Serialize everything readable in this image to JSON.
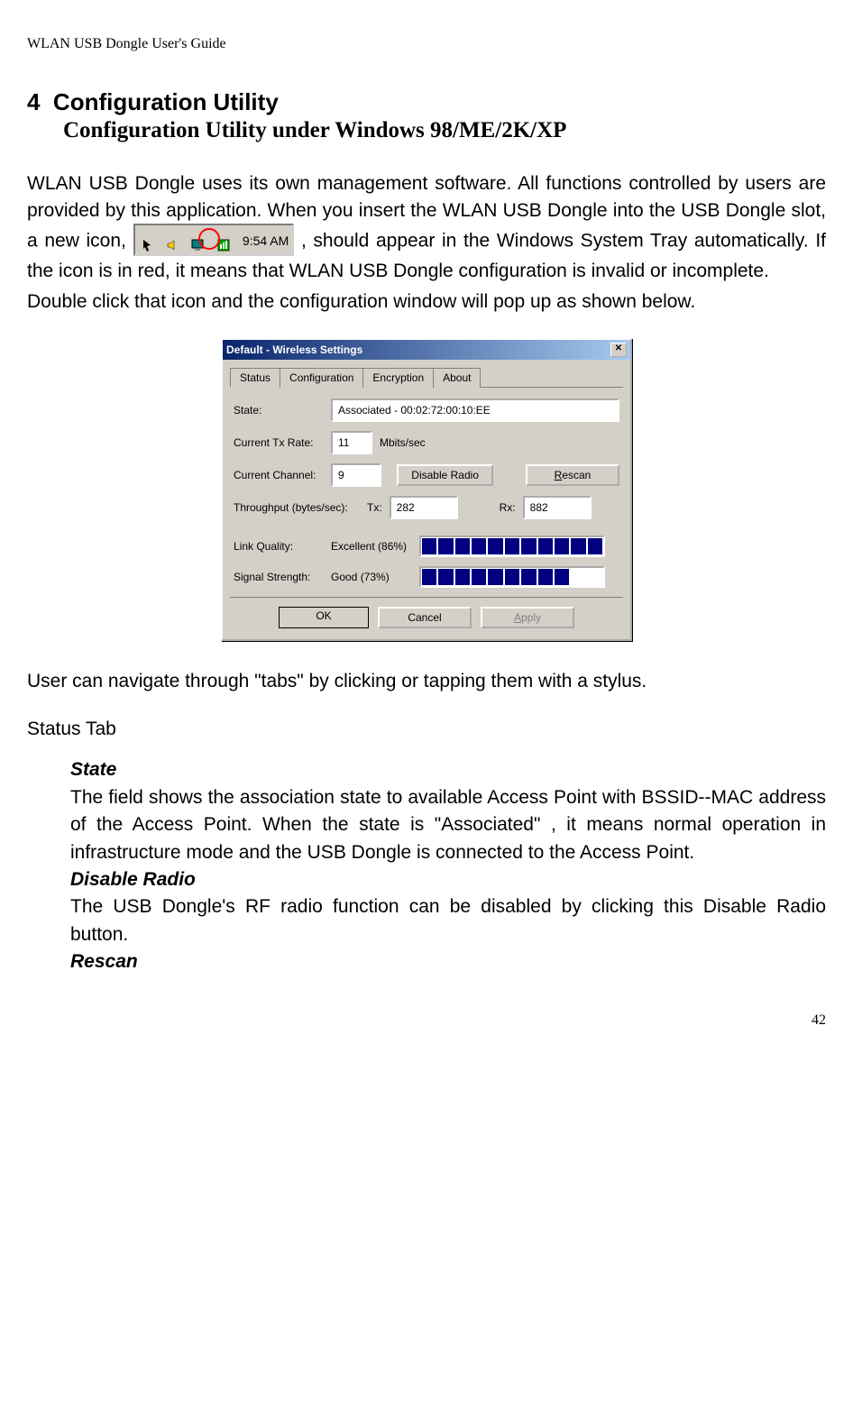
{
  "running_header": "WLAN USB Dongle User's Guide",
  "section": {
    "number": "4",
    "title": "Configuration Utility",
    "subtitle": "Configuration Utility under Windows 98/ME/2K/XP"
  },
  "paragraphs": {
    "p1a": "WLAN USB Dongle uses its own management software. All functions controlled by users are provided by this application. When you insert the WLAN USB Dongle into the USB Dongle slot, a new icon, ",
    "p1b": ", should appear in the Windows System Tray automatically. If the icon is in red, it means that WLAN USB Dongle configuration is invalid or incomplete.",
    "p2": "Double click that icon and the configuration window will pop up as shown below.",
    "p3": "User can navigate through \"tabs\" by clicking or tapping them with a stylus.",
    "status_tab_heading": "Status Tab",
    "state_heading": "State",
    "state_body": "The field shows the association state to available Access Point with BSSID--MAC address of the Access Point. When the state is \"Associated\" , it means normal operation in infrastructure mode and the USB Dongle is connected to the Access Point.",
    "disable_heading": "Disable Radio",
    "disable_body": "The USB Dongle's RF radio function can be disabled by clicking this Disable Radio button.",
    "rescan_heading": "Rescan"
  },
  "tray": {
    "time": "9:54 AM"
  },
  "dialog": {
    "title": "Default - Wireless Settings",
    "tabs": [
      "Status",
      "Configuration",
      "Encryption",
      "About"
    ],
    "state_label": "State:",
    "state_value": "Associated - 00:02:72:00:10:EE",
    "txrate_label": "Current Tx Rate:",
    "txrate_value": "11",
    "txrate_unit": "Mbits/sec",
    "channel_label": "Current Channel:",
    "channel_value": "9",
    "disable_radio_btn": "Disable Radio",
    "rescan_btn_first": "R",
    "rescan_btn_rest": "escan",
    "throughput_label": "Throughput (bytes/sec):",
    "tx_label": "Tx:",
    "tx_value": "282",
    "rx_label": "Rx:",
    "rx_value": "882",
    "link_label": "Link Quality:",
    "link_value": "Excellent (86%)",
    "signal_label": "Signal Strength:",
    "signal_value": "Good (73%)",
    "ok": "OK",
    "cancel": "Cancel",
    "apply_first": "A",
    "apply_rest": "pply"
  },
  "page_number": "42",
  "chart_data": [
    {
      "type": "bar",
      "title": "Link Quality",
      "values": [
        86
      ],
      "ylim": [
        0,
        100
      ],
      "segments_on": 11,
      "segments_total": 11
    },
    {
      "type": "bar",
      "title": "Signal Strength",
      "values": [
        73
      ],
      "ylim": [
        0,
        100
      ],
      "segments_on": 9,
      "segments_total": 11
    }
  ]
}
